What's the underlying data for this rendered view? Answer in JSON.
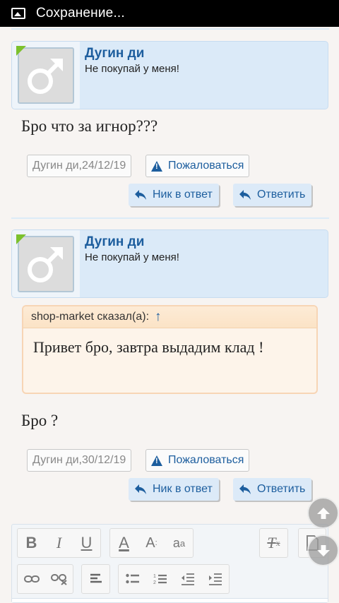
{
  "statusbar": {
    "title": "Сохранение..."
  },
  "posts": [
    {
      "user": {
        "name": "Дугин ди",
        "status": "Не покупай у меня!"
      },
      "message": "Бро что за игнор???",
      "meta": {
        "author": "Дугин ди",
        "sep": ", ",
        "date": "24/12/19"
      },
      "report_label": "Пожаловаться",
      "nick_reply_label": "Ник в ответ",
      "reply_label": "Ответить"
    },
    {
      "user": {
        "name": "Дугин ди",
        "status": "Не покупай у меня!"
      },
      "quote": {
        "author": "shop-market сказал(а):",
        "arrow": "↑",
        "text": "Привет бро, завтра выдадим клад !"
      },
      "message": "Бро ?",
      "meta": {
        "author": "Дугин ди",
        "sep": ", ",
        "date": "30/12/19"
      },
      "report_label": "Пожаловаться",
      "nick_reply_label": "Ник в ответ",
      "reply_label": "Ответить"
    }
  ],
  "colors": {
    "accent": "#1d5e9e",
    "header_bg": "#dbeaf8",
    "quote_bg": "#fdf4ea",
    "new_marker": "#7cc12d"
  },
  "editor": {
    "toolbar_row1": [
      "bold-icon",
      "italic-icon",
      "underline-icon",
      "text-color-icon",
      "font-size-icon",
      "font-family-icon",
      "remove-format-icon",
      "source-icon"
    ],
    "toolbar_row2": [
      "link-icon",
      "unlink-icon",
      "align-icon",
      "bullet-list-icon",
      "numbered-list-icon",
      "outdent-icon",
      "indent-icon"
    ]
  }
}
